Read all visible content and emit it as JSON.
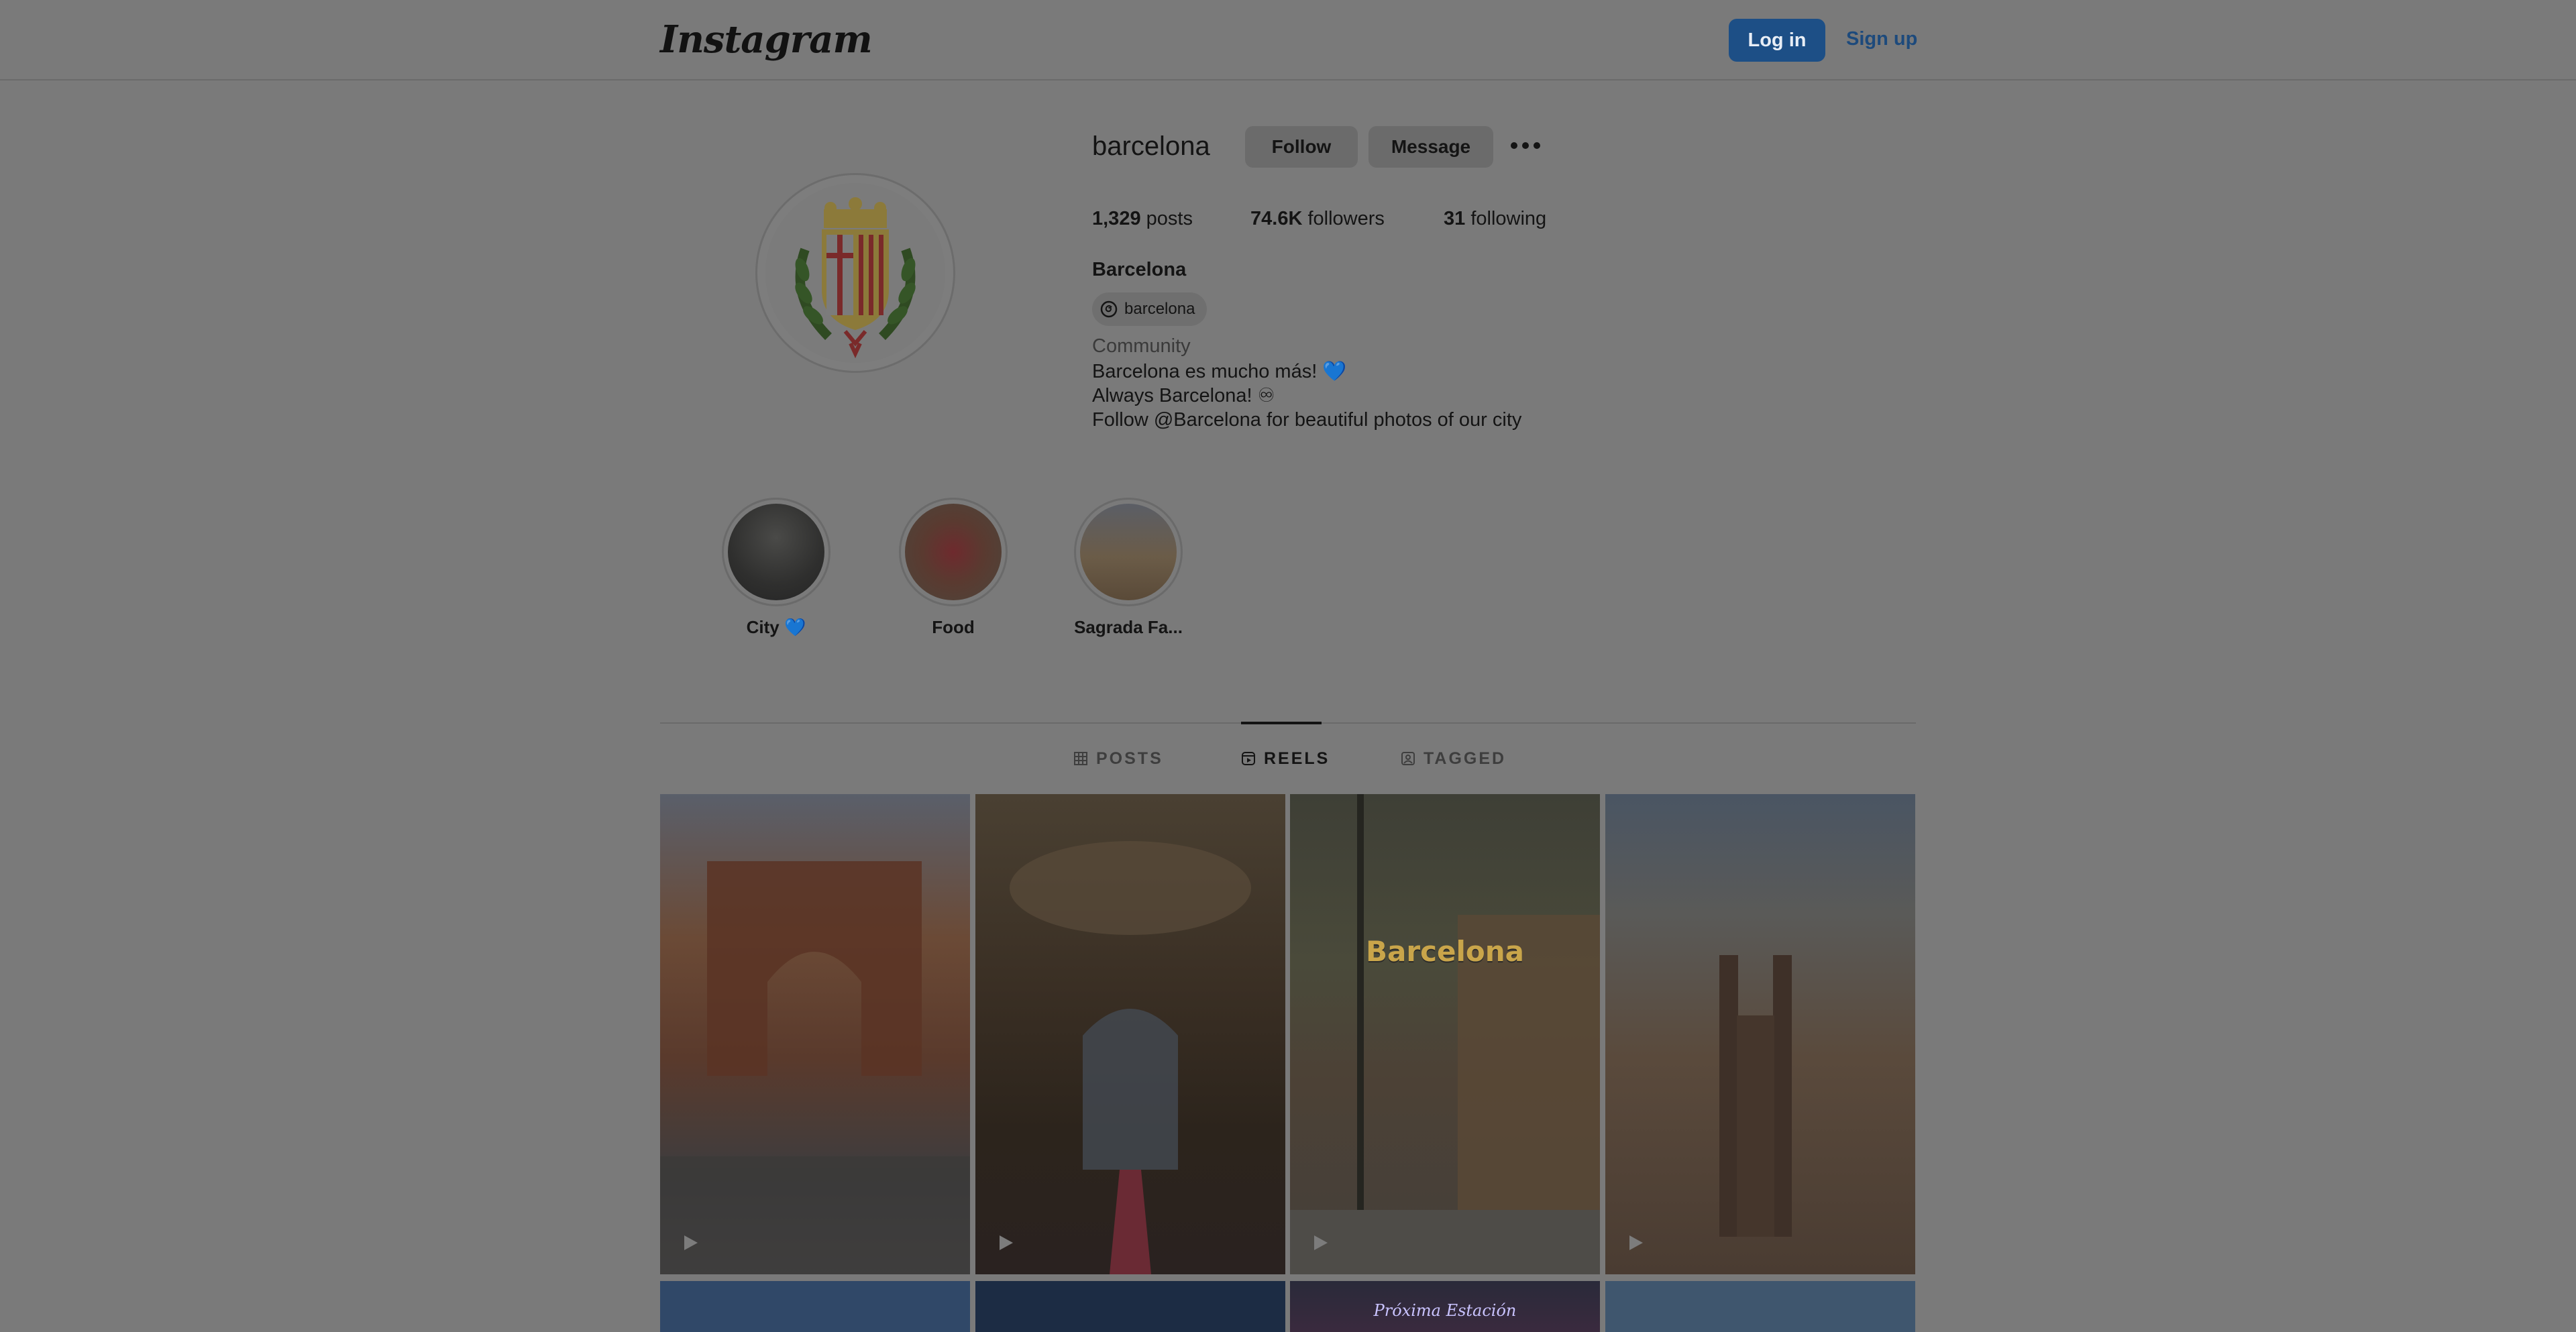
{
  "app": {
    "logo": "Instagram"
  },
  "header": {
    "login_label": "Log in",
    "signup_label": "Sign up"
  },
  "profile": {
    "username": "barcelona",
    "follow_label": "Follow",
    "message_label": "Message",
    "stats": {
      "posts_count": "1,329",
      "posts_label": "posts",
      "followers_count": "74.6K",
      "followers_label": "followers",
      "following_count": "31",
      "following_label": "following"
    },
    "full_name": "Barcelona",
    "threads_handle": "barcelona",
    "category": "Community",
    "bio": [
      "Barcelona es mucho más! 💙",
      "Always Barcelona! ♾",
      "Follow @Barcelona for beautiful photos of our city"
    ]
  },
  "highlights": [
    {
      "label": "City 💙"
    },
    {
      "label": "Food"
    },
    {
      "label": "Sagrada Fa..."
    }
  ],
  "tabs": [
    {
      "label": "POSTS",
      "icon": "grid-icon",
      "active": false
    },
    {
      "label": "REELS",
      "icon": "reels-icon",
      "active": true
    },
    {
      "label": "TAGGED",
      "icon": "tagged-icon",
      "active": false
    }
  ],
  "reels": [
    {
      "overlay_title": "",
      "overlay_sub": "",
      "icon": "play-icon"
    },
    {
      "overlay_title": "",
      "overlay_sub": "",
      "icon": "play-icon"
    },
    {
      "overlay_title": "Barcelona",
      "overlay_sub": "",
      "icon": "play-icon"
    },
    {
      "overlay_title": "",
      "overlay_sub": "",
      "icon": "play-icon"
    },
    {
      "overlay_title": "",
      "overlay_sub": "",
      "icon": ""
    },
    {
      "overlay_title": "",
      "overlay_sub": "",
      "icon": ""
    },
    {
      "overlay_title": "",
      "overlay_sub": "Próxima Estación",
      "icon": ""
    },
    {
      "overlay_title": "",
      "overlay_sub": "",
      "icon": ""
    }
  ],
  "colors": {
    "overlay_dim": "#7a7a7a",
    "login_button": "#1d4f86",
    "text": "#141414"
  }
}
